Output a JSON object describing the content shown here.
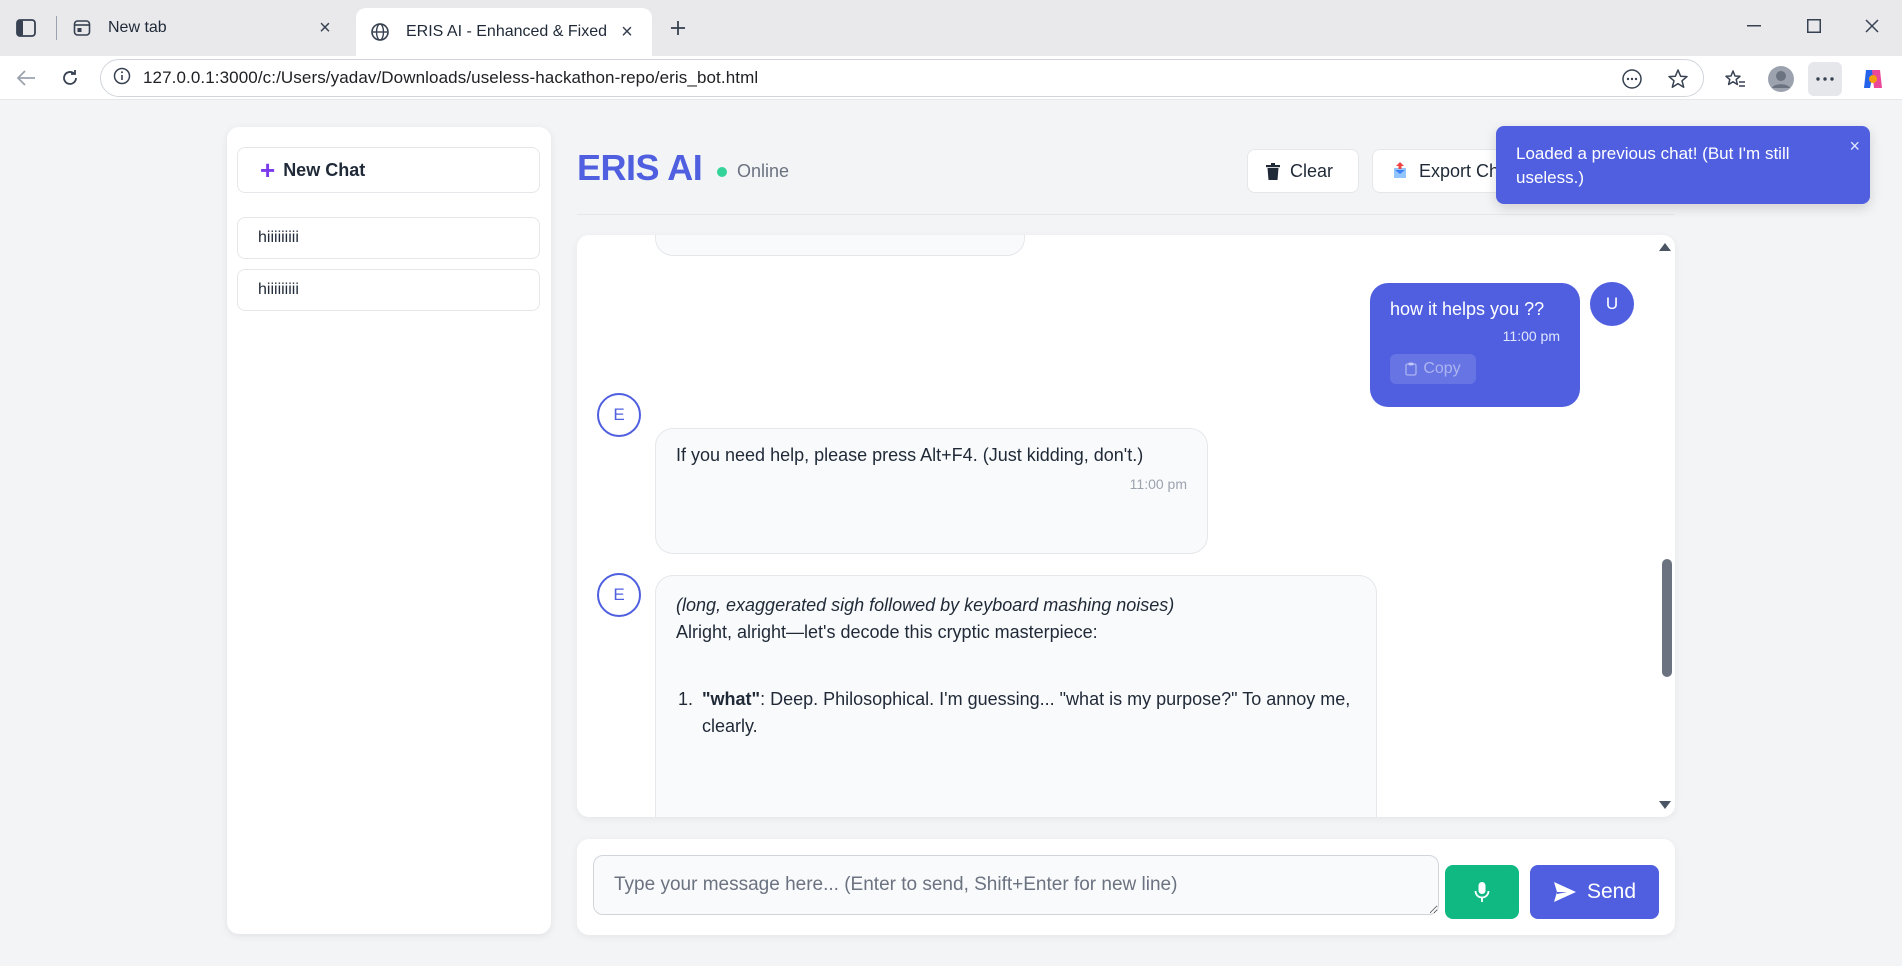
{
  "browser": {
    "tabs": [
      {
        "title": "New tab",
        "active": false
      },
      {
        "title": "ERIS AI - Enhanced & Fixed",
        "active": true
      }
    ],
    "url": "127.0.0.1:3000/c:/Users/yadav/Downloads/useless-hackathon-repo/eris_bot.html"
  },
  "sidebar": {
    "new_chat_label": "New Chat",
    "history": [
      {
        "label": "hiiiiiiiii"
      },
      {
        "label": "hiiiiiiiii"
      }
    ]
  },
  "header": {
    "title": "ERIS AI",
    "status": "Online",
    "clear_label": "Clear",
    "export_label": "Export Chat"
  },
  "messages": {
    "user_msg": {
      "avatar": "U",
      "text": "how it helps you ??",
      "time": "11:00 pm",
      "copy_label": "Copy"
    },
    "bot_msg_1": {
      "avatar": "E",
      "text": "If you need help, please press Alt+F4. (Just kidding, don't.)",
      "time": "11:00 pm"
    },
    "bot_msg_2": {
      "avatar": "E",
      "italic": "(long, exaggerated sigh followed by keyboard mashing noises)",
      "line2": "Alright, alright—let's decode this cryptic masterpiece:",
      "list": [
        {
          "bold": "\"what\"",
          "text": ": Deep. Philosophical. I'm guessing... \"what is my purpose?\" To annoy me, clearly."
        }
      ]
    }
  },
  "composer": {
    "placeholder": "Type your message here... (Enter to send, Shift+Enter for new line)",
    "send_label": "Send"
  },
  "toast": {
    "text": "Loaded a previous chat! (But I'm still useless.)",
    "close": "×"
  },
  "colors": {
    "accent": "#4f5fe0",
    "online": "#34d399",
    "mic": "#10b981"
  }
}
